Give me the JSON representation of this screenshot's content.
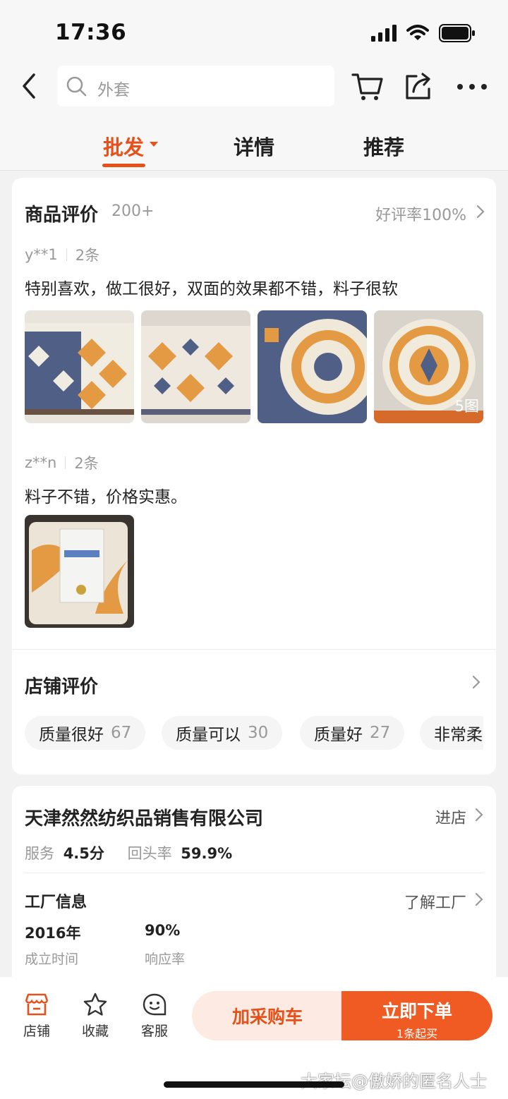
{
  "status": {
    "time": "17:36"
  },
  "search": {
    "placeholder": "外套"
  },
  "tabs": [
    {
      "label": "批发",
      "active": true
    },
    {
      "label": "详情",
      "active": false
    },
    {
      "label": "推荐",
      "active": false
    }
  ],
  "product_reviews": {
    "title": "商品评价",
    "count": "200+",
    "good_rate": "好评率100%",
    "reviews": [
      {
        "user": "y**1",
        "count": "2条",
        "text": "特别喜欢，做工很好，双面的效果都不错，料子很软",
        "photo_count_label": "5图"
      },
      {
        "user": "z**n",
        "count": "2条",
        "text": "料子不错，价格实惠。"
      }
    ]
  },
  "shop_reviews": {
    "title": "店铺评价",
    "tags": [
      {
        "label": "质量很好",
        "count": "67"
      },
      {
        "label": "质量可以",
        "count": "30"
      },
      {
        "label": "质量好",
        "count": "27"
      },
      {
        "label": "非常柔",
        "count": ""
      }
    ]
  },
  "shop": {
    "name": "天津然然纺织品销售有限公司",
    "enter_label": "进店",
    "service_label": "服务",
    "service_value": "4.5分",
    "return_label": "回头率",
    "return_value": "59.9%",
    "factory_title": "工厂信息",
    "factory_link": "了解工厂",
    "founded_value": "2016年",
    "founded_label": "成立时间",
    "response_value": "90%",
    "response_label": "响应率"
  },
  "bottom_bar": {
    "shop_label": "店铺",
    "fav_label": "收藏",
    "service_label": "客服",
    "cart_label": "加采购车",
    "buy_label": "立即下单",
    "buy_sub": "1条起买"
  },
  "watermark": "大家坛@傲娇的匿名人士",
  "colors": {
    "accent": "#e8501a",
    "accent_light": "#fdeae2",
    "buy_button": "#ef5b23"
  }
}
